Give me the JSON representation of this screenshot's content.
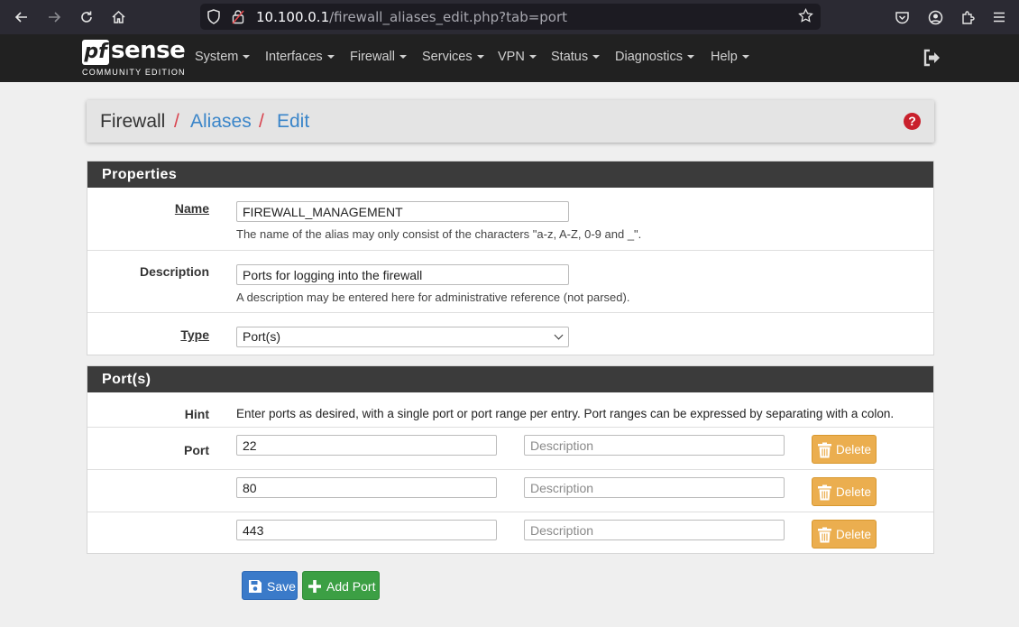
{
  "browser": {
    "url_host": "10.100.0.1",
    "url_path": "/firewall_aliases_edit.php?tab=port"
  },
  "navbar": {
    "logo_pf": "pf",
    "logo_sense": "sense",
    "logo_edition": "COMMUNITY EDITION",
    "menus": [
      "System",
      "Interfaces",
      "Firewall",
      "Services",
      "VPN",
      "Status",
      "Diagnostics",
      "Help"
    ]
  },
  "breadcrumb": {
    "items": [
      "Firewall",
      "Aliases",
      "Edit"
    ],
    "separator": "/",
    "help_glyph": "?"
  },
  "properties": {
    "heading": "Properties",
    "name_label": "Name",
    "name_value": "FIREWALL_MANAGEMENT",
    "name_help": "The name of the alias may only consist of the characters \"a-z, A-Z, 0-9 and _\".",
    "description_label": "Description",
    "description_value": "Ports for logging into the firewall",
    "description_help": "A description may be entered here for administrative reference (not parsed).",
    "type_label": "Type",
    "type_value": "Port(s)"
  },
  "ports": {
    "heading": "Port(s)",
    "hint_label": "Hint",
    "hint_text": "Enter ports as desired, with a single port or port range per entry. Port ranges can be expressed by separating with a colon.",
    "port_label": "Port",
    "description_placeholder": "Description",
    "delete_label": "Delete",
    "entries": [
      {
        "port": "22",
        "description": ""
      },
      {
        "port": "80",
        "description": ""
      },
      {
        "port": "443",
        "description": ""
      }
    ]
  },
  "actions": {
    "save_label": "Save",
    "add_port_label": "Add Port"
  },
  "colors": {
    "navbar_bg": "#212121",
    "panel_heading_bg": "#3b3b3b",
    "link": "#3a85c9",
    "separator": "#d9434e",
    "help_icon": "#c9202c",
    "delete_button": "#ebae4f",
    "save_button": "#3a7ac9",
    "add_button": "#3c9f44"
  },
  "icons": {
    "back": "arrow-left-icon",
    "forward": "arrow-right-icon",
    "reload": "reload-icon",
    "home": "home-icon",
    "shield": "shield-icon",
    "lock": "lock-icon",
    "bookmark": "star-icon",
    "pocket": "pocket-icon",
    "account": "account-icon",
    "extensions": "puzzle-icon",
    "menu": "hamburger-icon",
    "logout": "logout-icon",
    "help": "question-circle-icon",
    "delete": "trash-icon",
    "save": "floppy-icon",
    "add": "plus-icon"
  }
}
